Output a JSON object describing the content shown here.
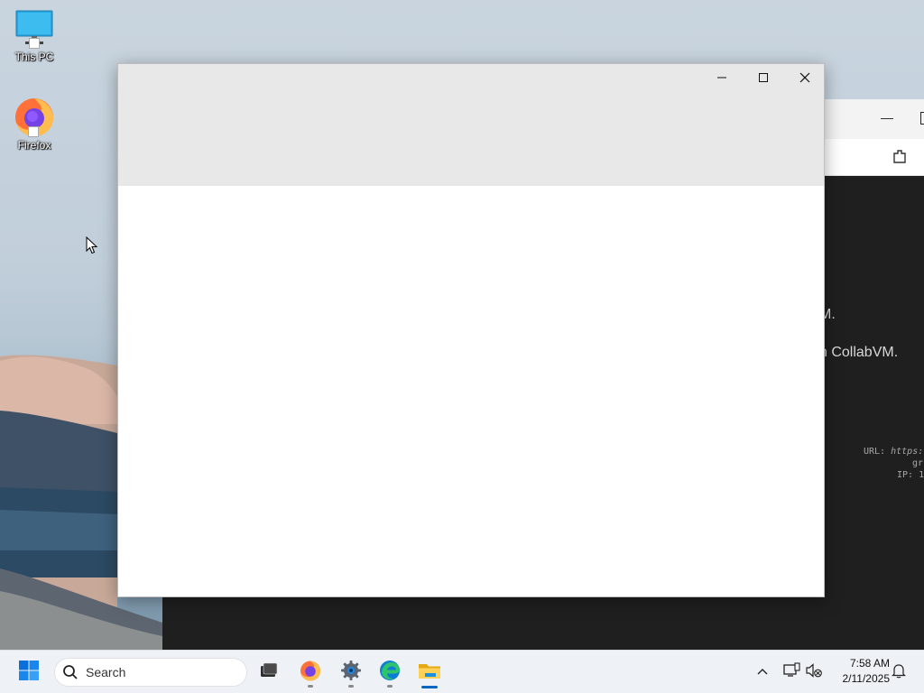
{
  "desktop": {
    "icons": [
      {
        "label": "This PC",
        "icon": "monitor-icon"
      },
      {
        "label": "Firefox",
        "icon": "firefox-icon"
      }
    ]
  },
  "background_window": {
    "visible_text_1": "M.",
    "visible_text_2": "n CollabVM.",
    "mono_line_1_prefix": "URL: ",
    "mono_line_1_value": "https:",
    "mono_line_2": "gr",
    "mono_line_3": "IP: 1"
  },
  "foreground_window": {
    "controls": [
      "minimize-icon",
      "maximize-icon",
      "close-icon"
    ]
  },
  "taskbar": {
    "search_placeholder": "Search",
    "apps": [
      "start-icon",
      "terminal-icon",
      "firefox-icon",
      "settings-icon",
      "edge-icon",
      "file-explorer-icon"
    ],
    "active_app": "file-explorer-icon",
    "tray_icons": [
      "chevron-up-icon",
      "network-icon",
      "volume-muted-icon",
      "notification-bell-icon"
    ],
    "time": "7:58 AM",
    "date": "2/11/2025"
  },
  "colors": {
    "accent": "#0067c0",
    "terminal_bg": "#1f1f1f",
    "window_header": "#e8e8e8"
  }
}
